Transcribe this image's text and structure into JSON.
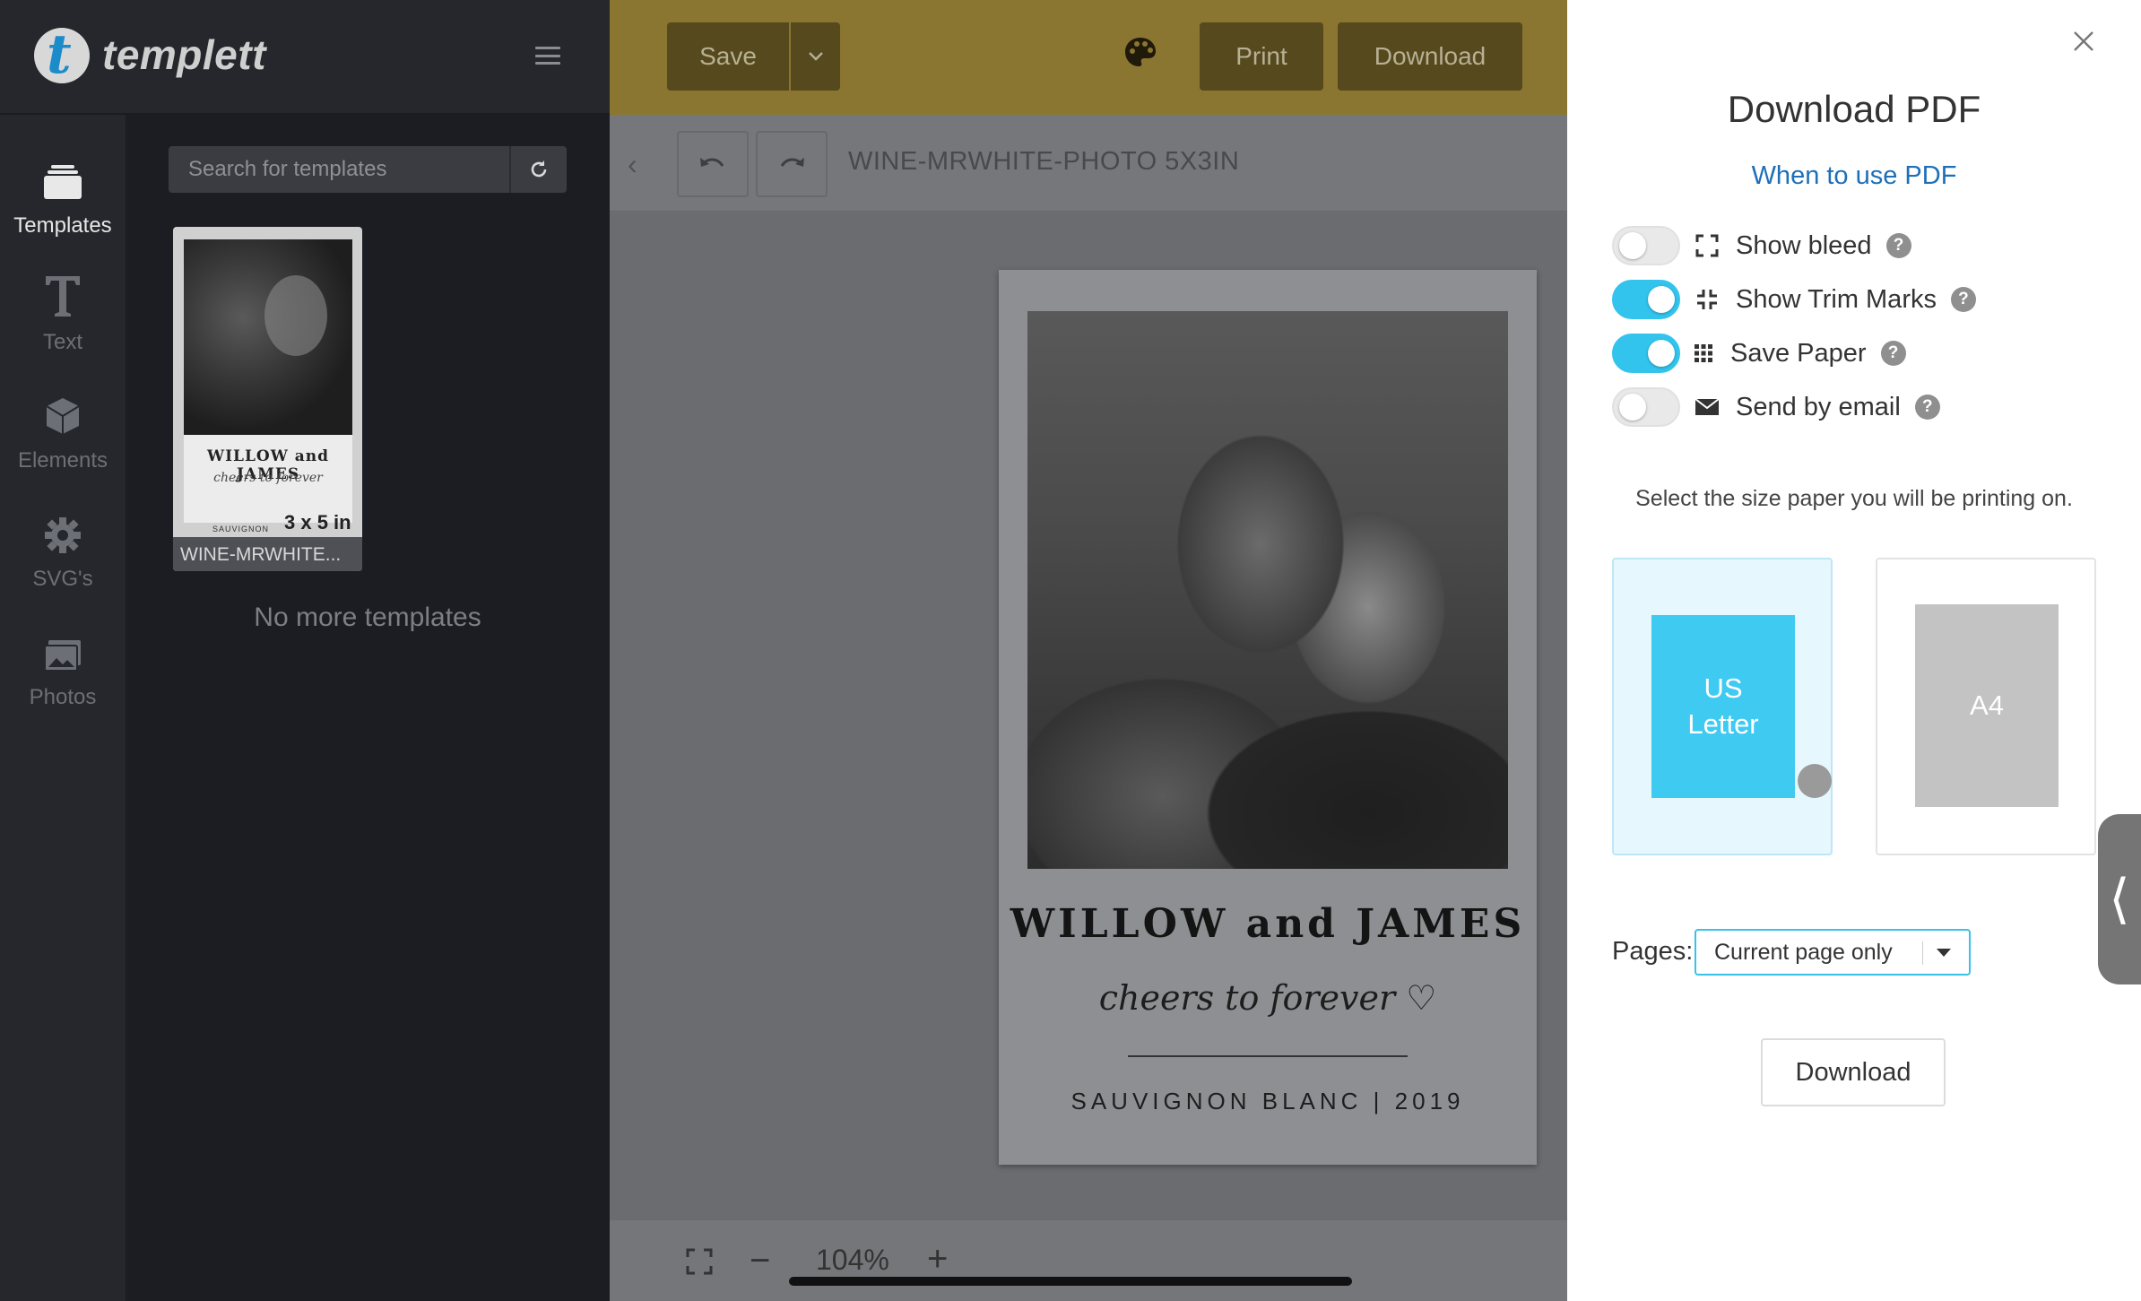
{
  "app": {
    "logo_text": "templett",
    "logo_letter": "t"
  },
  "rail": {
    "items": [
      {
        "label": "Templates",
        "icon": "layers-icon",
        "active": true
      },
      {
        "label": "Text",
        "icon": "text-icon"
      },
      {
        "label": "Elements",
        "icon": "cube-icon"
      },
      {
        "label": "SVG's",
        "icon": "gear-icon"
      },
      {
        "label": "Photos",
        "icon": "image-icon"
      }
    ]
  },
  "panel": {
    "search_placeholder": "Search for templates",
    "template": {
      "caption": "WINE-MRWHITE...",
      "title": "WILLOW and JAMES",
      "script": "cheers to forever",
      "size": "3 x 5 in",
      "sub": "SAUVIGNON"
    },
    "no_more": "No more templates"
  },
  "topbar": {
    "save": "Save",
    "print": "Print",
    "download": "Download"
  },
  "toolbar": {
    "doc_name": "WINE-MRWHITE-PHOTO 5X3IN"
  },
  "card": {
    "title": "WILLOW and JAMES",
    "script": "cheers to forever ♡",
    "sub": "SAUVIGNON BLANC | 2019"
  },
  "zoom": {
    "level": "104%"
  },
  "modal": {
    "title": "Download PDF",
    "link": "When to use PDF",
    "options": [
      {
        "label": "Show bleed",
        "on": false,
        "icon": "bleed-icon"
      },
      {
        "label": "Show Trim Marks",
        "on": true,
        "icon": "trim-marks-icon"
      },
      {
        "label": "Save Paper",
        "on": true,
        "icon": "grid-icon"
      },
      {
        "label": "Send by email",
        "on": false,
        "icon": "envelope-icon"
      }
    ],
    "help_glyph": "?",
    "paper_note": "Select the size paper you will be printing on.",
    "papers": [
      {
        "label_line1": "US",
        "label_line2": "Letter",
        "selected": true
      },
      {
        "label": "A4",
        "selected": false
      }
    ],
    "pages_label": "Pages:",
    "pages_value": "Current page only",
    "download": "Download"
  },
  "colors": {
    "accent": "#33c4ee",
    "topbar": "#8a7630",
    "link": "#1e6fb8"
  }
}
